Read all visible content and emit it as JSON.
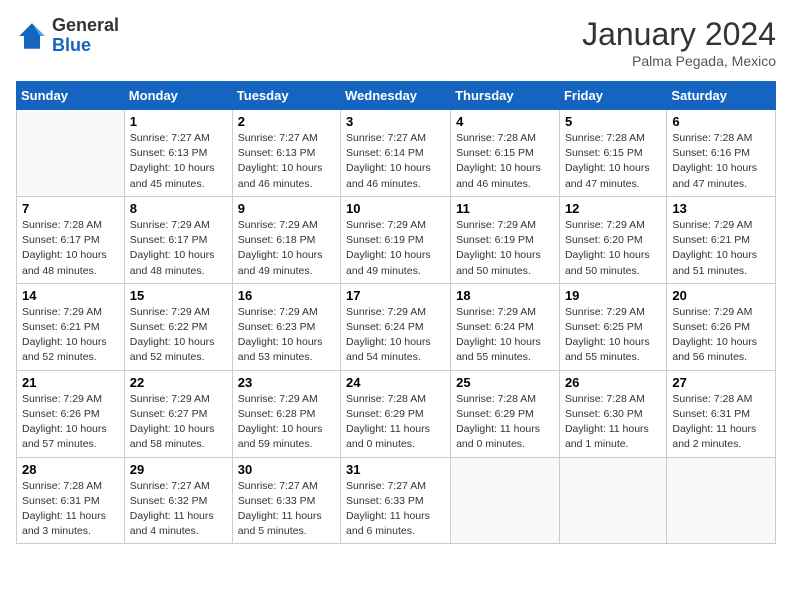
{
  "header": {
    "logo_general": "General",
    "logo_blue": "Blue",
    "month_year": "January 2024",
    "location": "Palma Pegada, Mexico"
  },
  "days_of_week": [
    "Sunday",
    "Monday",
    "Tuesday",
    "Wednesday",
    "Thursday",
    "Friday",
    "Saturday"
  ],
  "weeks": [
    [
      {
        "day": "",
        "info": ""
      },
      {
        "day": "1",
        "info": "Sunrise: 7:27 AM\nSunset: 6:13 PM\nDaylight: 10 hours\nand 45 minutes."
      },
      {
        "day": "2",
        "info": "Sunrise: 7:27 AM\nSunset: 6:13 PM\nDaylight: 10 hours\nand 46 minutes."
      },
      {
        "day": "3",
        "info": "Sunrise: 7:27 AM\nSunset: 6:14 PM\nDaylight: 10 hours\nand 46 minutes."
      },
      {
        "day": "4",
        "info": "Sunrise: 7:28 AM\nSunset: 6:15 PM\nDaylight: 10 hours\nand 46 minutes."
      },
      {
        "day": "5",
        "info": "Sunrise: 7:28 AM\nSunset: 6:15 PM\nDaylight: 10 hours\nand 47 minutes."
      },
      {
        "day": "6",
        "info": "Sunrise: 7:28 AM\nSunset: 6:16 PM\nDaylight: 10 hours\nand 47 minutes."
      }
    ],
    [
      {
        "day": "7",
        "info": "Sunrise: 7:28 AM\nSunset: 6:17 PM\nDaylight: 10 hours\nand 48 minutes."
      },
      {
        "day": "8",
        "info": "Sunrise: 7:29 AM\nSunset: 6:17 PM\nDaylight: 10 hours\nand 48 minutes."
      },
      {
        "day": "9",
        "info": "Sunrise: 7:29 AM\nSunset: 6:18 PM\nDaylight: 10 hours\nand 49 minutes."
      },
      {
        "day": "10",
        "info": "Sunrise: 7:29 AM\nSunset: 6:19 PM\nDaylight: 10 hours\nand 49 minutes."
      },
      {
        "day": "11",
        "info": "Sunrise: 7:29 AM\nSunset: 6:19 PM\nDaylight: 10 hours\nand 50 minutes."
      },
      {
        "day": "12",
        "info": "Sunrise: 7:29 AM\nSunset: 6:20 PM\nDaylight: 10 hours\nand 50 minutes."
      },
      {
        "day": "13",
        "info": "Sunrise: 7:29 AM\nSunset: 6:21 PM\nDaylight: 10 hours\nand 51 minutes."
      }
    ],
    [
      {
        "day": "14",
        "info": "Sunrise: 7:29 AM\nSunset: 6:21 PM\nDaylight: 10 hours\nand 52 minutes."
      },
      {
        "day": "15",
        "info": "Sunrise: 7:29 AM\nSunset: 6:22 PM\nDaylight: 10 hours\nand 52 minutes."
      },
      {
        "day": "16",
        "info": "Sunrise: 7:29 AM\nSunset: 6:23 PM\nDaylight: 10 hours\nand 53 minutes."
      },
      {
        "day": "17",
        "info": "Sunrise: 7:29 AM\nSunset: 6:24 PM\nDaylight: 10 hours\nand 54 minutes."
      },
      {
        "day": "18",
        "info": "Sunrise: 7:29 AM\nSunset: 6:24 PM\nDaylight: 10 hours\nand 55 minutes."
      },
      {
        "day": "19",
        "info": "Sunrise: 7:29 AM\nSunset: 6:25 PM\nDaylight: 10 hours\nand 55 minutes."
      },
      {
        "day": "20",
        "info": "Sunrise: 7:29 AM\nSunset: 6:26 PM\nDaylight: 10 hours\nand 56 minutes."
      }
    ],
    [
      {
        "day": "21",
        "info": "Sunrise: 7:29 AM\nSunset: 6:26 PM\nDaylight: 10 hours\nand 57 minutes."
      },
      {
        "day": "22",
        "info": "Sunrise: 7:29 AM\nSunset: 6:27 PM\nDaylight: 10 hours\nand 58 minutes."
      },
      {
        "day": "23",
        "info": "Sunrise: 7:29 AM\nSunset: 6:28 PM\nDaylight: 10 hours\nand 59 minutes."
      },
      {
        "day": "24",
        "info": "Sunrise: 7:28 AM\nSunset: 6:29 PM\nDaylight: 11 hours\nand 0 minutes."
      },
      {
        "day": "25",
        "info": "Sunrise: 7:28 AM\nSunset: 6:29 PM\nDaylight: 11 hours\nand 0 minutes."
      },
      {
        "day": "26",
        "info": "Sunrise: 7:28 AM\nSunset: 6:30 PM\nDaylight: 11 hours\nand 1 minute."
      },
      {
        "day": "27",
        "info": "Sunrise: 7:28 AM\nSunset: 6:31 PM\nDaylight: 11 hours\nand 2 minutes."
      }
    ],
    [
      {
        "day": "28",
        "info": "Sunrise: 7:28 AM\nSunset: 6:31 PM\nDaylight: 11 hours\nand 3 minutes."
      },
      {
        "day": "29",
        "info": "Sunrise: 7:27 AM\nSunset: 6:32 PM\nDaylight: 11 hours\nand 4 minutes."
      },
      {
        "day": "30",
        "info": "Sunrise: 7:27 AM\nSunset: 6:33 PM\nDaylight: 11 hours\nand 5 minutes."
      },
      {
        "day": "31",
        "info": "Sunrise: 7:27 AM\nSunset: 6:33 PM\nDaylight: 11 hours\nand 6 minutes."
      },
      {
        "day": "",
        "info": ""
      },
      {
        "day": "",
        "info": ""
      },
      {
        "day": "",
        "info": ""
      }
    ]
  ]
}
